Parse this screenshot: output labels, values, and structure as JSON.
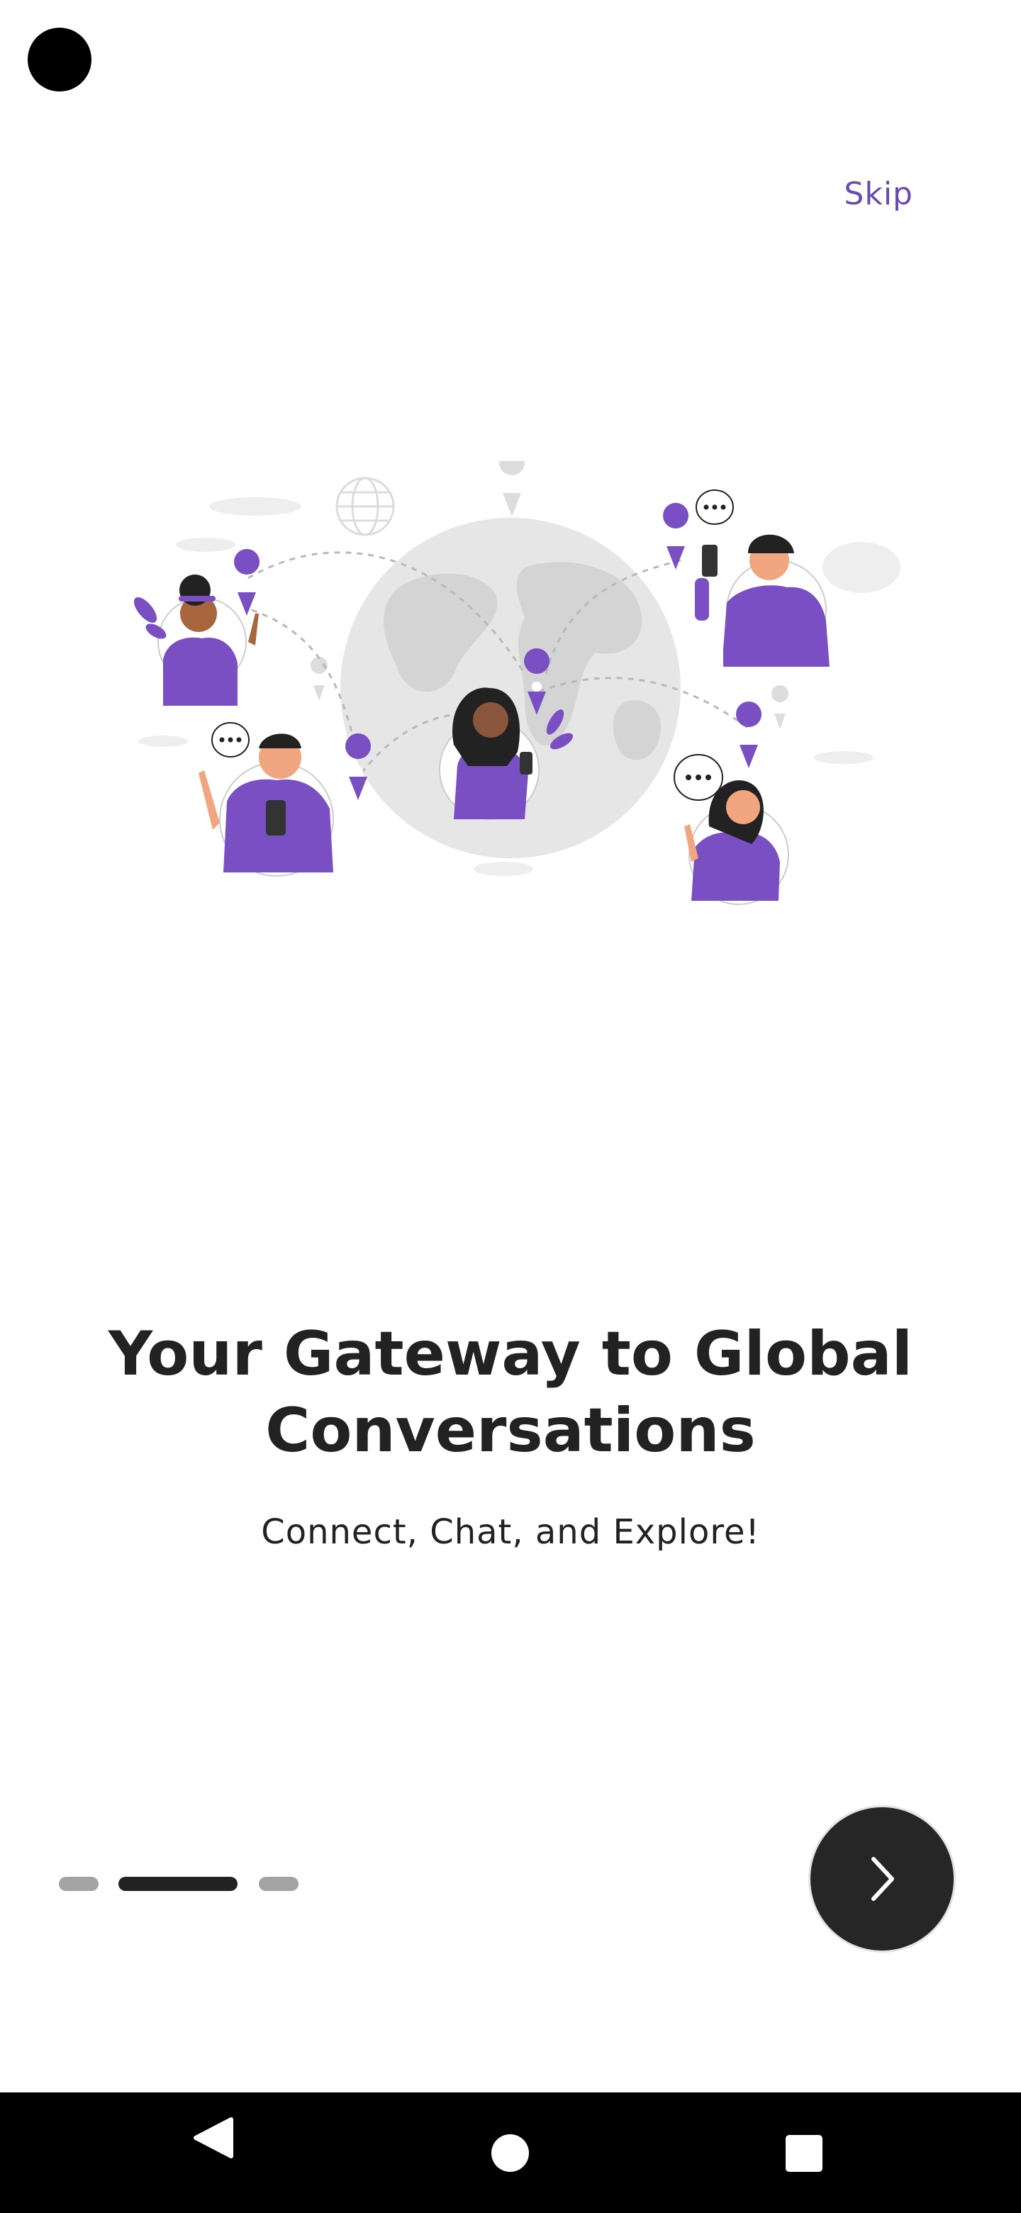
{
  "header": {
    "skip_label": "Skip"
  },
  "onboarding": {
    "title": "Your Gateway to Global Conversations",
    "subtitle": "Connect, Chat, and Explore!",
    "page_indicator": {
      "count": 3,
      "active_index": 1
    }
  },
  "icons": {
    "next": "chevron-right-icon",
    "nav_back": "back-triangle-icon",
    "nav_home": "home-circle-icon",
    "nav_recents": "recents-square-icon"
  },
  "colors": {
    "accent": "#6a4bb0",
    "illustration_purple": "#7b4fc4",
    "dark": "#222222",
    "inactive_dot": "#a3a3a3"
  }
}
